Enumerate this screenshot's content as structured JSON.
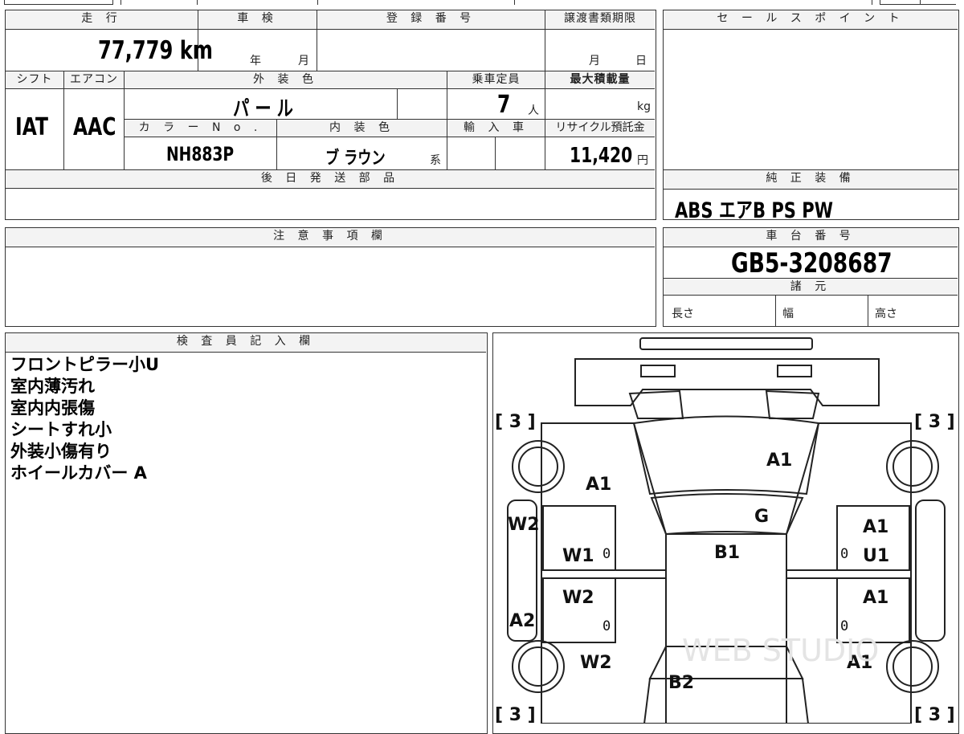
{
  "header": {
    "mileage_label": "走 行",
    "shaken_label": "車 検",
    "registration_label": "登 録 番 号",
    "transfer_deadline_label": "譲渡書類期限",
    "sales_point_label": "セ ー ル ス ポ イ ン ト"
  },
  "values": {
    "mileage": "77,779 km",
    "shaken_year": "年",
    "shaken_month": "月",
    "transfer_month": "月",
    "transfer_day": "日"
  },
  "row2": {
    "shift_label": "シフト",
    "aircon_label": "エアコン",
    "exterior_color_label": "外 装 色",
    "capacity_label": "乗車定員",
    "max_load_label": "最大積載量",
    "shift": "IAT",
    "aircon": "AAC",
    "exterior_color": "パ ー ル",
    "capacity": "7",
    "capacity_unit": "人",
    "max_load_unit": "kg"
  },
  "row3": {
    "color_no_label": "カ ラ ー N o .",
    "interior_color_label": "内 装 色",
    "import_label": "輸 入 車",
    "recycle_label": "リサイクル預託金",
    "color_no": "NH883P",
    "interior_color": "ブ ラウン",
    "interior_suffix": "系",
    "recycle_fee": "11,420",
    "recycle_unit": "円"
  },
  "parts": {
    "later_shipping_label": "後 日 発 送 部 品",
    "genuine_equipment_label": "純 正 装 備",
    "genuine_equipment": "ABS  エアB  PS  PW"
  },
  "notes": {
    "caution_label": "注 意 事 項 欄",
    "chassis_label": "車 台 番 号",
    "chassis_number": "GB5-3208687",
    "specs_label": "諸 元",
    "length_label": "長さ",
    "width_label": "幅",
    "height_label": "高さ"
  },
  "inspector": {
    "label": "検 査 員 記 入 欄",
    "lines": [
      "フロントピラー小U",
      "室内薄汚れ",
      "室内内張傷",
      "シートすれ小",
      "外装小傷有り",
      "ホイールカバー A"
    ]
  },
  "diagram": {
    "tire_marks": [
      "[ 3 ]",
      "[ 3 ]",
      "[ 3 ]",
      "[ 3 ]"
    ],
    "marks": {
      "hood": "A1",
      "front_left_fender": "A1",
      "windshield": "G",
      "roof": "B1",
      "front_right_door": "A1",
      "front_right_door_2": "U1",
      "rear_right_door": "A1",
      "rear_right_fender": "A1",
      "left_pillar": "W2",
      "left_pillar_2": "A2",
      "front_left_door": "W1",
      "rear_left_door": "W2",
      "rear_left_fender": "W2",
      "trunk": "B2",
      "zero": "0"
    },
    "watermark": "WEB STUDIO"
  }
}
